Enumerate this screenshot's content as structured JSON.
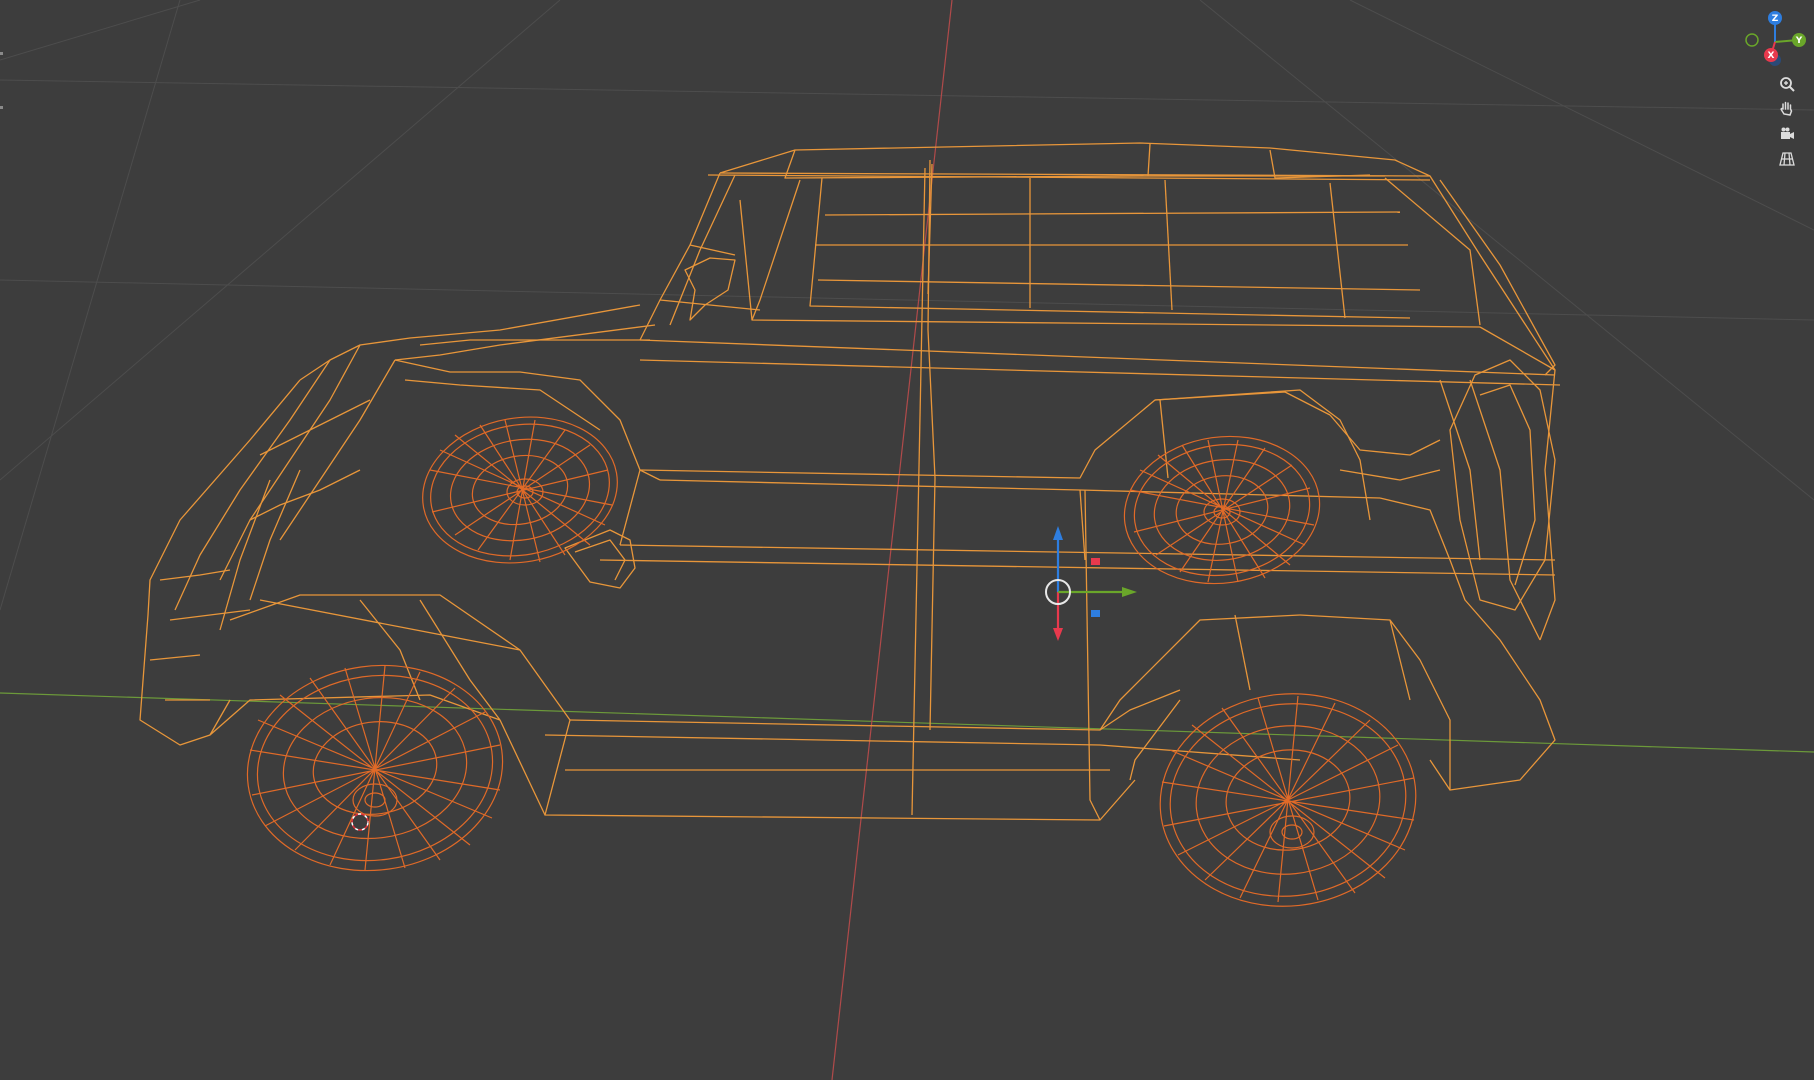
{
  "colors": {
    "background": "#3d3d3d",
    "grid": "#4b4b4b",
    "x_axis_line": "#b04a4a",
    "y_axis_line": "#6c9a3a",
    "wire_selected_body": "#e8963a",
    "wire_selected_wheels": "#e06a28",
    "gizmo_x": "#e8394d",
    "gizmo_y": "#6aa62a",
    "gizmo_z": "#2e7ee0"
  },
  "viewport": {
    "mode": "wireframe",
    "object": "car",
    "selected": true
  },
  "navigation_gizmo": {
    "axes": [
      {
        "label": "Z",
        "color": "#2e7ee0"
      },
      {
        "label": "Y",
        "color": "#6aa62a"
      },
      {
        "label": "X",
        "color": "#e8394d"
      }
    ],
    "buttons": [
      {
        "name": "zoom-icon"
      },
      {
        "name": "hand-pan-icon"
      },
      {
        "name": "camera-view-icon"
      },
      {
        "name": "perspective-grid-icon"
      }
    ]
  },
  "transform_gizmo": {
    "axes": [
      "X",
      "Y",
      "Z"
    ]
  }
}
